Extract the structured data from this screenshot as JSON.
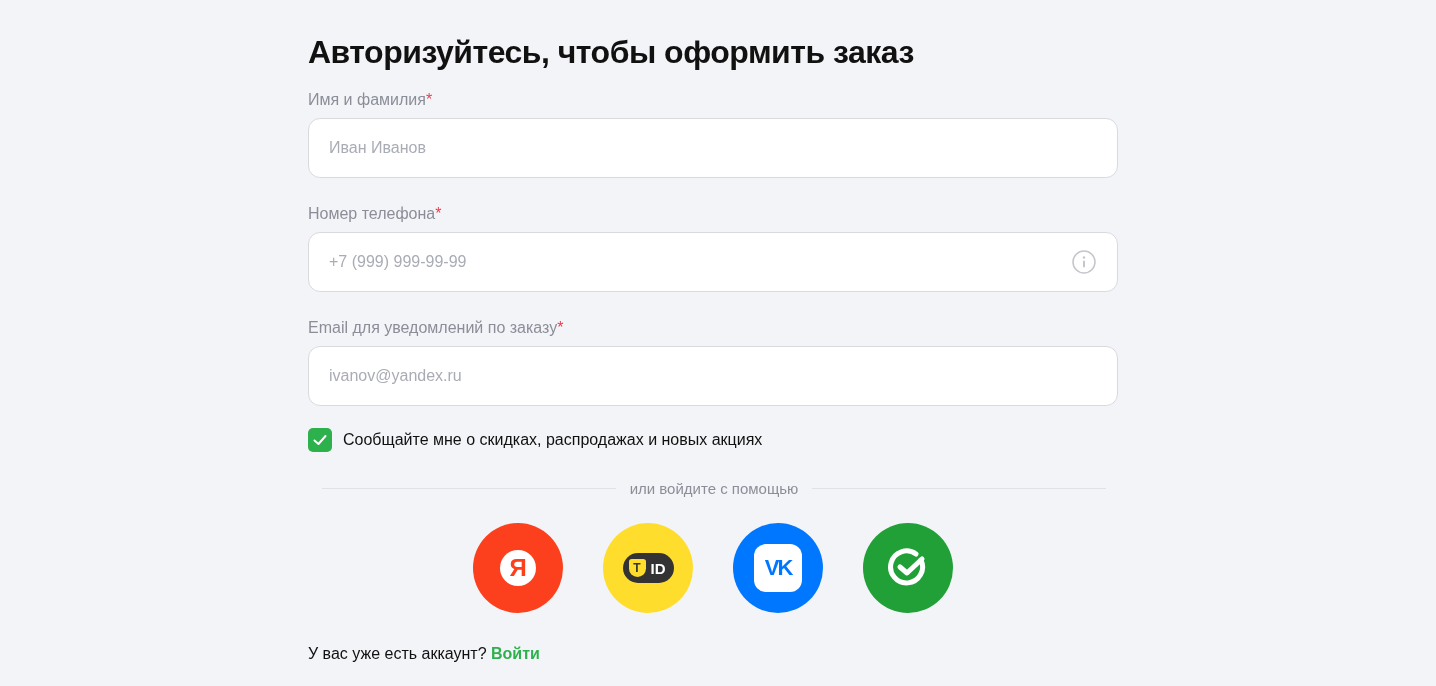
{
  "title": "Авторизуйтесь, чтобы оформить заказ",
  "fields": [
    {
      "label": "Имя и фамилия",
      "required_mark": "*",
      "placeholder": "Иван Иванов",
      "info_icon": false
    },
    {
      "label": "Номер телефона",
      "required_mark": "*",
      "placeholder": "+7 (999) 999-99-99",
      "info_icon": true
    },
    {
      "label": "Email для уведомлений по заказу",
      "required_mark": "*",
      "placeholder": "ivanov@yandex.ru",
      "info_icon": false
    }
  ],
  "subscribe": {
    "label": "Сообщайте мне о скидках, распродажах и новых акциях",
    "checked": true
  },
  "divider_text": "или войдите с помощью",
  "providers": [
    {
      "kind": "ya",
      "logo_text": "Я",
      "color": "#fc3f1d"
    },
    {
      "kind": "tid",
      "logo_text": "T",
      "logo_text_2": "ID",
      "color": "#ffdd2d"
    },
    {
      "kind": "vk",
      "logo_text": "VK",
      "color": "#0077ff"
    },
    {
      "kind": "sber",
      "color": "#21a038"
    }
  ],
  "footer": {
    "text": "У вас уже есть аккаунт?",
    "link": "Войти"
  }
}
